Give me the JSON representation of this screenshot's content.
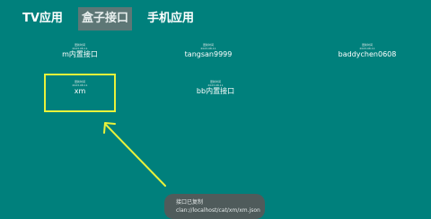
{
  "tabs": [
    {
      "label": "TV应用",
      "active": false
    },
    {
      "label": "盒子接口",
      "active": true
    },
    {
      "label": "手机应用",
      "active": false
    }
  ],
  "items": [
    {
      "label": "m内置接口",
      "badge": [
        "更新时间",
        "2023.08.11"
      ]
    },
    {
      "label": "tangsan9999",
      "badge": [
        "更新时间",
        "2023.08.11"
      ]
    },
    {
      "label": "baddychen0608",
      "badge": [
        "更新时间",
        "2023.08.11"
      ]
    },
    {
      "label": "xm",
      "badge": [
        "更新时间",
        "2023.08.11"
      ],
      "focused": true
    },
    {
      "label": "bb内置接口",
      "badge": [
        "更新时间",
        "2023.08.11"
      ]
    }
  ],
  "toast": {
    "line1": "接口已复制",
    "line2": "clan://localhost/cat/xm/xm.json"
  },
  "colors": {
    "background": "#00807c",
    "active_tab": "#5d7776",
    "annotation": "#e9f23a",
    "toast": "#4f5b5b"
  }
}
